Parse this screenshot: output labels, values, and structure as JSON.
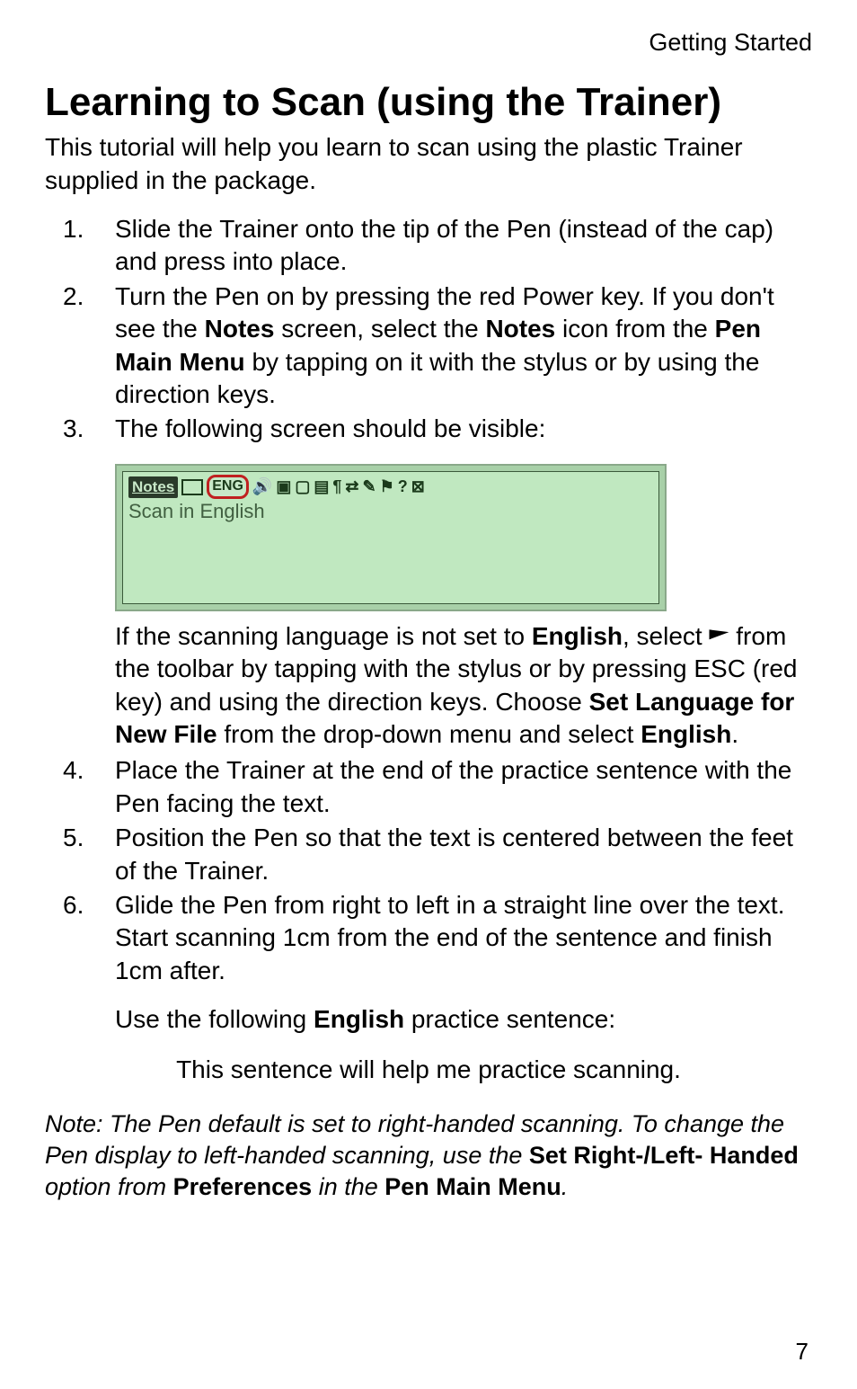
{
  "header": {
    "section": "Getting Started"
  },
  "title": "Learning to Scan (using the Trainer)",
  "intro": "This tutorial will help you learn to scan using the plastic Trainer supplied in the package.",
  "steps": {
    "s1": {
      "num": "1.",
      "text_a": "Slide the Trainer onto the tip of the Pen (instead of the cap) and press into place."
    },
    "s2": {
      "num": "2.",
      "text_a": "Turn the Pen on by pressing the red Power key. If you don't see the ",
      "notes1": "Notes",
      "text_b": " screen, select the ",
      "notes2": "Notes",
      "text_c": " icon from the ",
      "menu": "Pen Main Menu",
      "text_d": " by tapping on it with the stylus or by using the direction keys."
    },
    "s3": {
      "num": "3.",
      "text_a": "The following screen should be visible:"
    },
    "screen": {
      "toolbar": {
        "notes": "Notes",
        "eng": "ENG",
        "q": "?",
        "x": "⊠"
      },
      "scan_text": "Scan in English"
    },
    "s3_after": {
      "text_a": "If the scanning language is not set to ",
      "english1": "English",
      "text_b": ", select ",
      "text_c": " from the toolbar by tapping with the stylus or by pressing ESC (red key) and using the direction keys. Choose ",
      "setlang": "Set Language for New File",
      "text_d": " from the drop-down menu and select ",
      "english2": "English",
      "text_e": "."
    },
    "s4": {
      "num": "4.",
      "text_a": "Place the Trainer at the end of the practice sentence with the Pen facing the text."
    },
    "s5": {
      "num": "5.",
      "text_a": "Position the Pen so that the text is centered between the feet of the Trainer."
    },
    "s6": {
      "num": "6.",
      "text_a": "Glide the Pen from right to left in a straight line over the text. Start scanning 1cm from the end of the sentence and finish 1cm after."
    },
    "use_following_a": "Use the following ",
    "use_following_b": "English",
    "use_following_c": " practice sentence:"
  },
  "practice": "This sentence will help me practice scanning.",
  "note": {
    "a": "Note: The Pen default is set to right-handed scanning. To change the Pen display to left-handed scanning, use the ",
    "b": "Set Right-/Left- Handed",
    "c": " option from ",
    "d": "Preferences",
    "e": " in the ",
    "f": "Pen Main Menu",
    "g": "."
  },
  "page_number": "7"
}
